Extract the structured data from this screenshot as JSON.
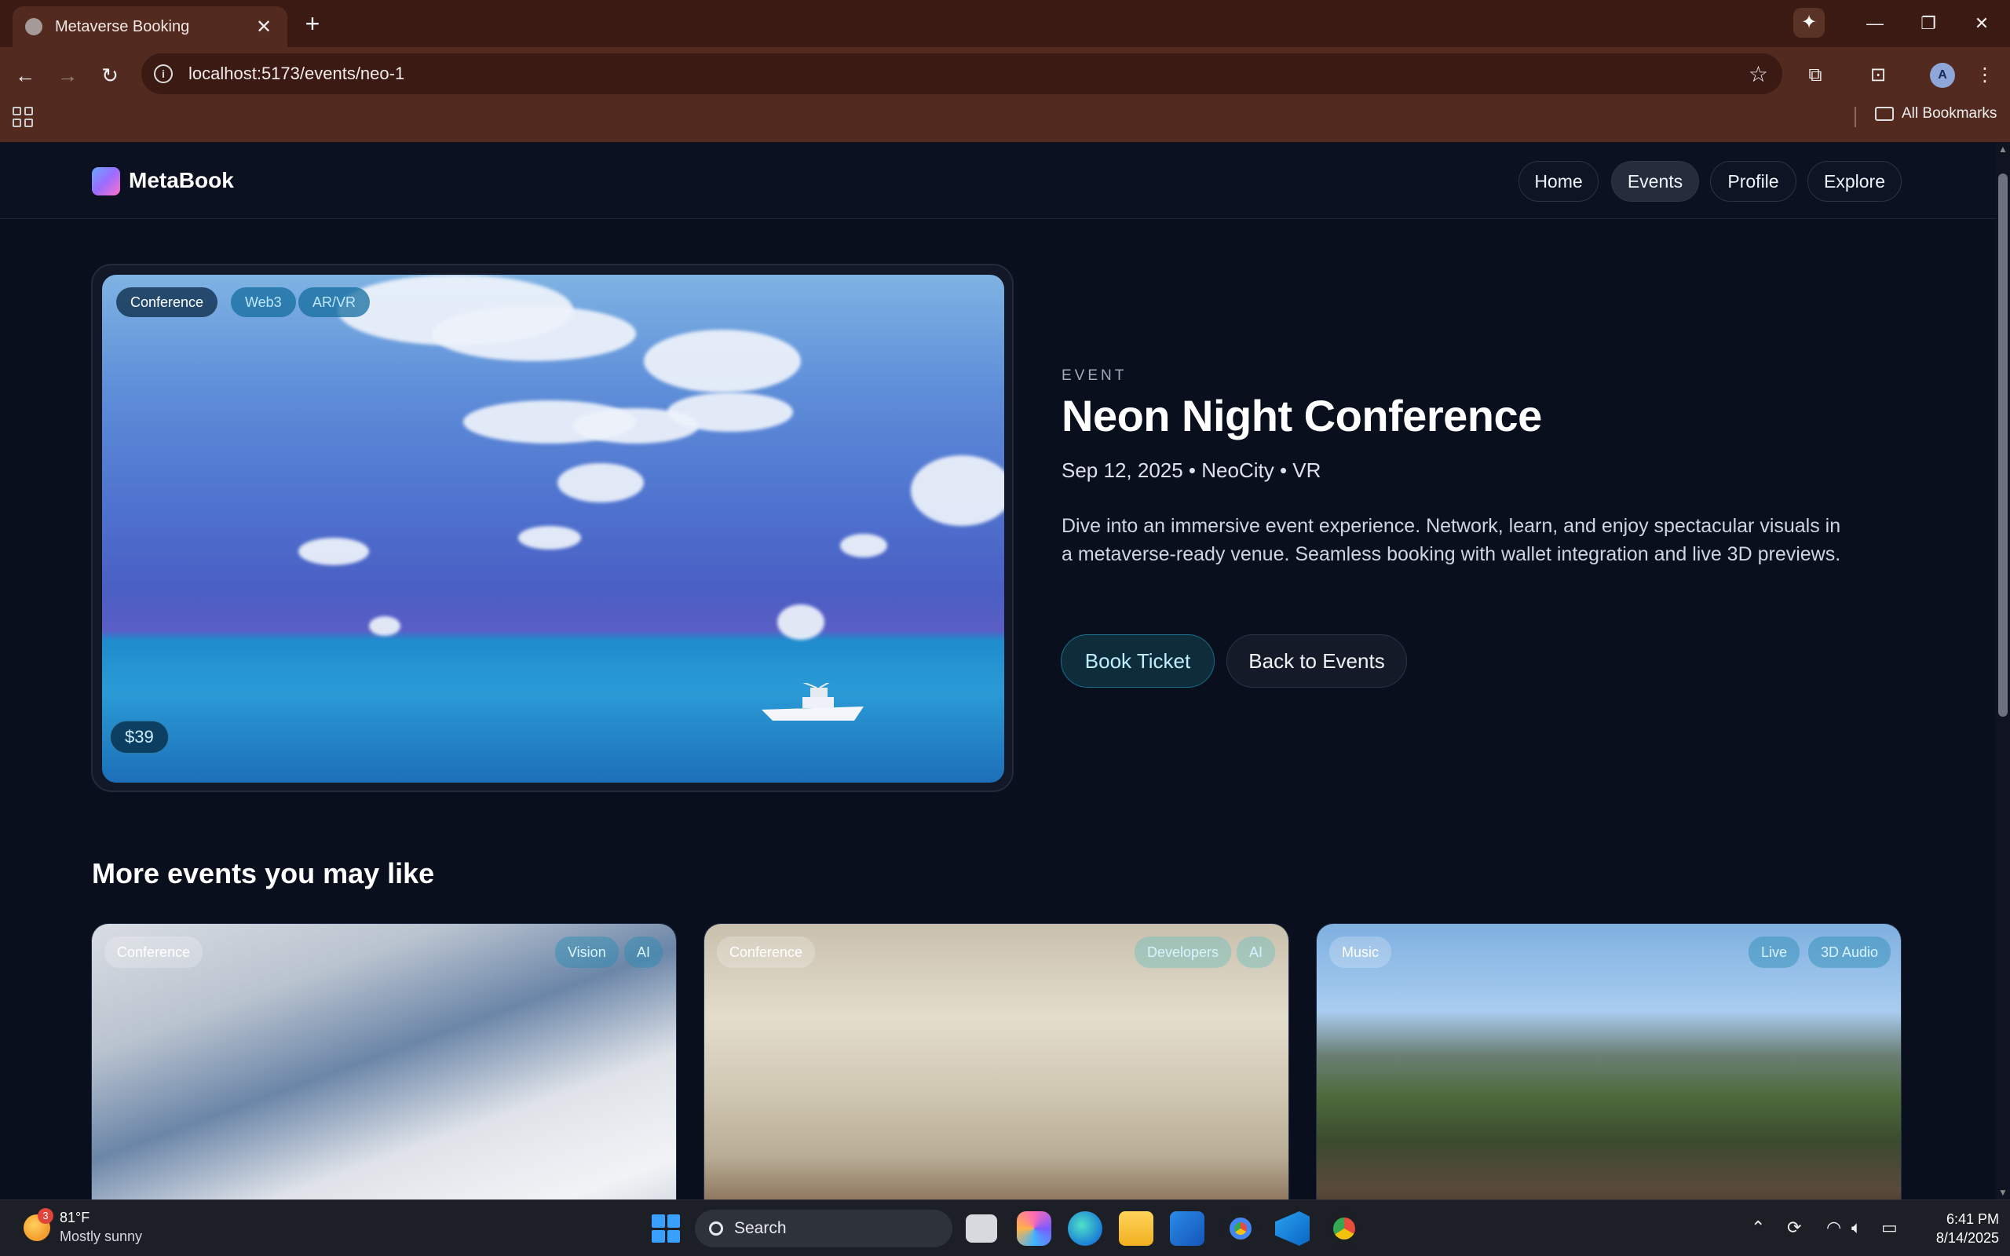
{
  "browser": {
    "tab_title": "Metaverse Booking",
    "url": "localhost:5173/events/neo-1",
    "profile_initial": "A",
    "bookmarks_label": "All Bookmarks"
  },
  "site": {
    "brand": "MetaBook",
    "nav": [
      "Home",
      "Events",
      "Profile",
      "Explore"
    ],
    "active_nav": "Events"
  },
  "event": {
    "tags": [
      "Conference",
      "Web3",
      "AR/VR"
    ],
    "price": "$39",
    "eyebrow": "EVENT",
    "title": "Neon Night Conference",
    "meta": "Sep 12, 2025 • NeoCity • VR",
    "description": "Dive into an immersive event experience. Network, learn, and enjoy spectacular visuals in a metaverse-ready venue. Seamless booking with wallet integration and live 3D previews.",
    "primary_action": "Book Ticket",
    "secondary_action": "Back to Events"
  },
  "related": {
    "heading": "More events you may like",
    "cards": [
      {
        "category": "Conference",
        "tags": [
          "Vision",
          "AI"
        ]
      },
      {
        "category": "Conference",
        "tags": [
          "Developers",
          "AI"
        ]
      },
      {
        "category": "Music",
        "tags": [
          "Live",
          "3D Audio"
        ]
      }
    ]
  },
  "taskbar": {
    "weather_badge": "3",
    "temperature": "81°F",
    "condition": "Mostly sunny",
    "search_label": "Search",
    "time": "6:41 PM",
    "date": "8/14/2025"
  },
  "colors": {
    "page_bg": "#0a0f1e",
    "accent": "#1b6f8d",
    "chrome": "#532a20"
  }
}
